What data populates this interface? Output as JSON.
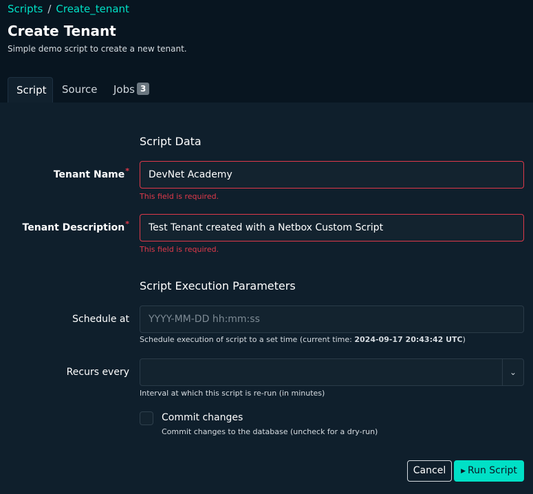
{
  "breadcrumb": {
    "items": [
      "Scripts",
      "Create_tenant"
    ],
    "separator": "/"
  },
  "page": {
    "title": "Create Tenant",
    "description": "Simple demo script to create a new tenant."
  },
  "tabs": [
    {
      "label": "Script",
      "active": true
    },
    {
      "label": "Source",
      "active": false
    },
    {
      "label": "Jobs",
      "active": false,
      "badge": "3"
    }
  ],
  "script_data": {
    "section_title": "Script Data",
    "tenant_name": {
      "label": "Tenant Name",
      "required_marker": "*",
      "value": "DevNet Academy",
      "error": "This field is required."
    },
    "tenant_description": {
      "label": "Tenant Description",
      "required_marker": "*",
      "value": "Test Tenant created with a Netbox Custom Script",
      "error": "This field is required."
    }
  },
  "execution": {
    "section_title": "Script Execution Parameters",
    "schedule_at": {
      "label": "Schedule at",
      "placeholder": "YYYY-MM-DD hh:mm:ss",
      "help_prefix": "Schedule execution of script to a set time (current time: ",
      "current_time": "2024-09-17 20:43:42 UTC",
      "help_suffix": ")"
    },
    "recurs_every": {
      "label": "Recurs every",
      "value": "",
      "help": "Interval at which this script is re-run (in minutes)"
    },
    "commit": {
      "label": "Commit changes",
      "checked": false,
      "help": "Commit changes to the database (uncheck for a dry-run)"
    }
  },
  "actions": {
    "cancel_label": "Cancel",
    "run_label": "Run Script"
  },
  "colors": {
    "accent": "#00e0c6",
    "error": "#e0394a",
    "background": "#0f1f2c"
  }
}
